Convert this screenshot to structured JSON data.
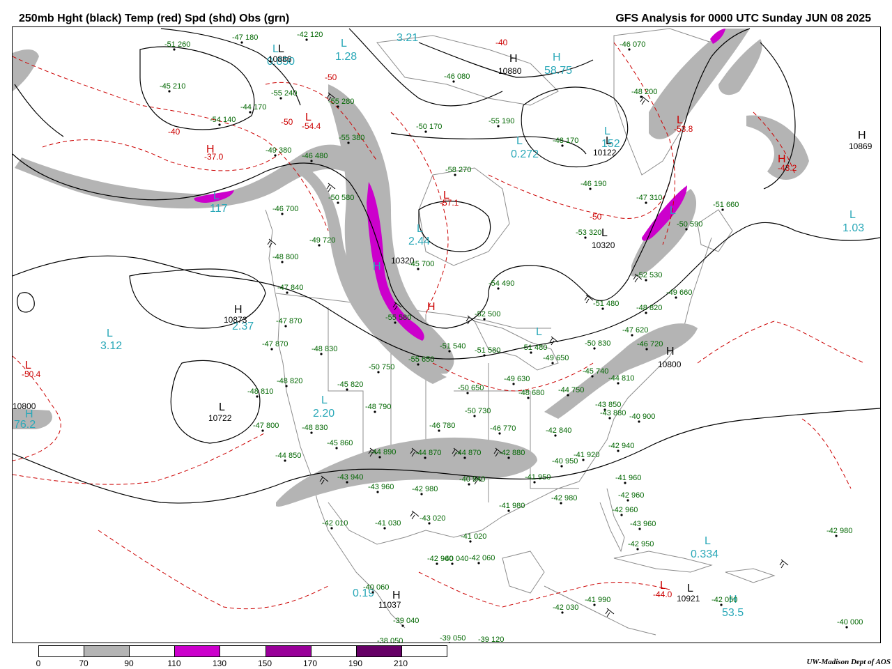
{
  "title_left": "250mb Hght (black) Temp (red) Spd (shd) Obs (grn)",
  "title_right": "GFS Analysis for 0000 UTC Sunday  JUN 08 2025",
  "credit": "UW-Madison  Dept of AOS",
  "colors": {
    "height_contour": "#000000",
    "temp_contour": "#cc0000",
    "geography": "#888888",
    "speed_70_90": "#b4b4b4",
    "speed_110_130": "#cc00cc",
    "speed_150_170": "#990099",
    "speed_190_210": "#660066",
    "obs": "#006600",
    "center_labels": "#2aa8b8"
  },
  "speed_legend": {
    "labels": [
      "0",
      "70",
      "90",
      "110",
      "130",
      "150",
      "170",
      "190",
      "210"
    ],
    "segments": [
      "#ffffff",
      "#b4b4b4",
      "#ffffff",
      "#cc00cc",
      "#ffffff",
      "#990099",
      "#ffffff",
      "#660066",
      "#ffffff"
    ]
  },
  "height_centers": [
    {
      "type": "L",
      "value": "10886"
    },
    {
      "type": "H",
      "value": "10880"
    },
    {
      "type": "L",
      "value": "10122"
    },
    {
      "type": "H",
      "value": "10869"
    },
    {
      "type": "L",
      "value": "10320"
    },
    {
      "type": "H",
      "value": "10873"
    },
    {
      "type": "L",
      "value": "10722"
    },
    {
      "type": "H",
      "value": "10800"
    },
    {
      "type": "L",
      "value": "10921"
    },
    {
      "type": "H",
      "value": "11037"
    }
  ],
  "height_labels": [
    "10320",
    "10800"
  ],
  "temp_labels": [
    "-50",
    "-40",
    "-50",
    "-54.4",
    "-40",
    "-37.0",
    "-57.1",
    "-50",
    "-53.8",
    "-43.2",
    "-50.4",
    "-44.0"
  ],
  "cyan_labels": [
    "0.850",
    "1.28",
    "3.21",
    "58.75",
    "0.272",
    "152",
    "117",
    "2.44",
    "1.03",
    "3.12",
    "2.37",
    "2.20",
    "0.334",
    "53.5",
    "0.19",
    "76.2"
  ],
  "observations": [
    "-42 120",
    "-47 180",
    "-51 260",
    "-45 210",
    "-55 240",
    "-44 170",
    "-54 140",
    "-55 280",
    "-49 380",
    "-46 480",
    "-55 380",
    "-50 170",
    "-46 080",
    "-55 190",
    "-48 170",
    "-48 200",
    "-46 070",
    "-58 270",
    "-46 190",
    "-47 310",
    "-51 660",
    "-50 580",
    "-46 700",
    "-53 320",
    "-50 590",
    "-49 720",
    "-48 800",
    "-45 700",
    "-52 530",
    "-47 840",
    "-54 490",
    "-49 660",
    "-51 480",
    "-48 820",
    "-47 870",
    "-52 500",
    "-55 580",
    "-47 620",
    "-47 870",
    "-48 830",
    "-51 540",
    "-51 580",
    "-51 480",
    "-55 650",
    "-49 650",
    "-50 830",
    "-46 720",
    "-50 750",
    "-50 650",
    "-49 630",
    "-48 820",
    "-48 810",
    "-45 820",
    "-45 740",
    "-44 810",
    "-48 680",
    "-44 750",
    "-48 790",
    "-46 780",
    "-50 730",
    "-46 770",
    "-43 850",
    "-43 880",
    "-40 900",
    "-47 800",
    "-48 830",
    "-42 840",
    "-42 940",
    "-44 850",
    "-45 860",
    "-44 890",
    "-44 870",
    "-44 870",
    "-42 880",
    "-40 950",
    "-41 920",
    "-41 960",
    "-43 940",
    "-43 960",
    "-42 980",
    "-40 940",
    "-41 950",
    "-42 980",
    "-41 980",
    "-42 960",
    "-42 960",
    "-43 960",
    "-42 950",
    "-42 980",
    "-42 010",
    "-41 030",
    "-43 020",
    "-41 020",
    "-42 960",
    "-42 060",
    "-40 040",
    "-40 060",
    "-39 040",
    "-42 030",
    "-41 990",
    "-42 050",
    "-38 050",
    "-39 050",
    "-39 120",
    "-40 000"
  ]
}
